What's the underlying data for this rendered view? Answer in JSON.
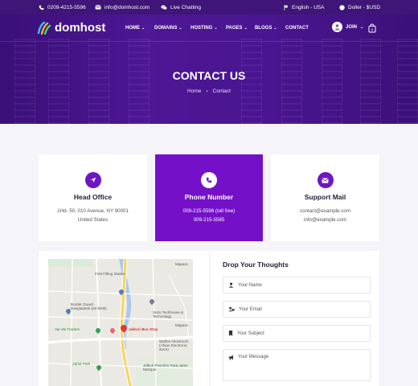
{
  "topbar": {
    "phone": "0209-4215-5596",
    "email": "info@domhost.com",
    "chat": "Live Chatting",
    "language": "English - USA",
    "currency": "Doller - $USD"
  },
  "brand": {
    "name": "domhost"
  },
  "nav": {
    "items": [
      "HOME",
      "DOMAINS",
      "HOSTING",
      "PAGES",
      "BLOGS",
      "CONTACT"
    ],
    "join": "JOIN"
  },
  "hero": {
    "title": "CONTACT US",
    "breadcrumb": [
      "Home",
      "Contact"
    ]
  },
  "cards": [
    {
      "title": "Head Office",
      "lines": [
        "1Hd- 50, 010 Avenue, NY 90001",
        "United States"
      ],
      "icon": "location-arrow-icon"
    },
    {
      "title": "Phone Number",
      "lines": [
        "009-215-5596 (toll free)",
        "009-215-5585"
      ],
      "icon": "phone-icon"
    },
    {
      "title": "Support Mail",
      "lines": [
        "contact@example.com",
        "info@example.com"
      ],
      "icon": "envelope-icon"
    }
  ],
  "map": {
    "labels": [
      "Mapara",
      "First Filling Station",
      "Border Guard Bangladesh (62 BGB)",
      "Sezo Techhouse & Technology",
      "Vai-Vai Traders",
      "Jalkuri Bus Stop",
      "Mapara",
      "Walton showroom (Afnan Electronic store)",
      "Zahid Park",
      "Jalkuri Poschim Para Jame Mosque"
    ],
    "pin_label": "Jalkuri Bus Stop"
  },
  "form": {
    "title": "Drop Your Thoughts",
    "fields": [
      {
        "placeholder": "Your Name",
        "icon": "user-icon"
      },
      {
        "placeholder": "Your Email",
        "icon": "email-user-icon"
      },
      {
        "placeholder": "Your Subject",
        "icon": "bookmark-icon"
      },
      {
        "placeholder": "Your Message",
        "icon": "megaphone-icon"
      }
    ]
  },
  "colors": {
    "brand_purple": "#7411c8",
    "topbar": "#3f1578",
    "hero": "#4a1590",
    "pin_red": "#e03a2f"
  }
}
